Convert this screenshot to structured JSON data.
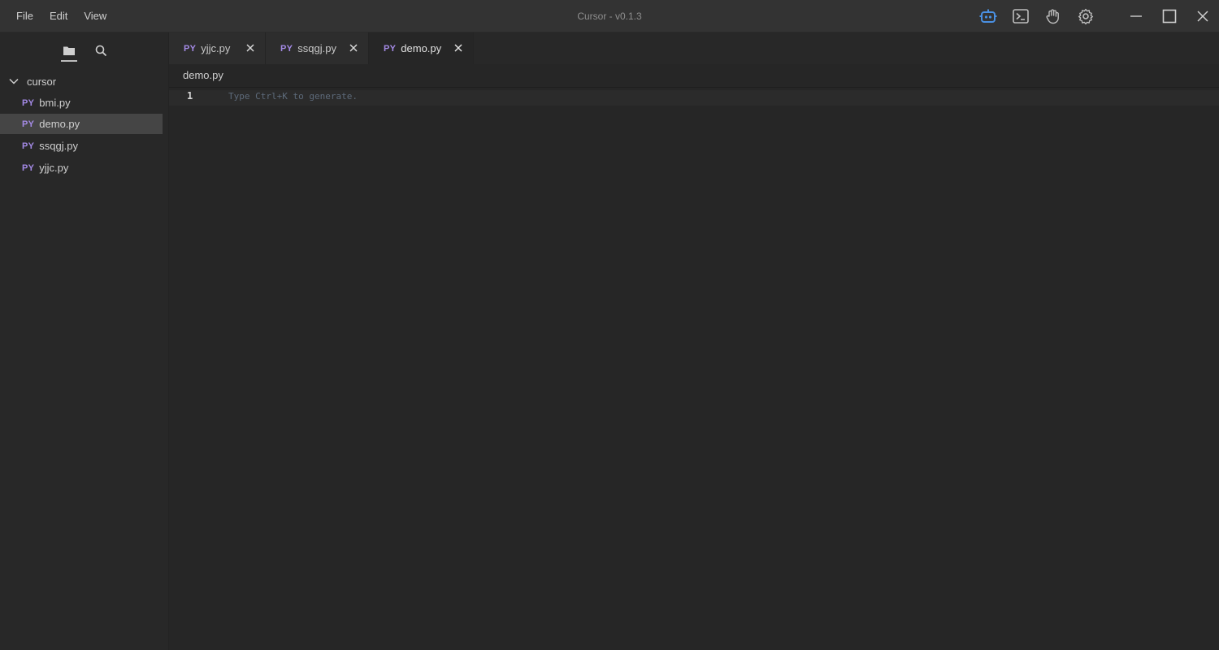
{
  "menu": [
    "File",
    "Edit",
    "View"
  ],
  "window": {
    "title": "Cursor - v0.1.3"
  },
  "title_icons": [
    "robot-icon",
    "terminal-icon",
    "hand-icon",
    "gear-icon"
  ],
  "colors": {
    "accent": "#4a90e2",
    "py_badge": "#a48ae6",
    "background": "#262626",
    "sidebar": "#282828",
    "titlebar": "#333333"
  },
  "sidebar": {
    "tabs": [
      "folder-icon",
      "search-icon"
    ],
    "folder": "cursor",
    "files": [
      {
        "badge": "PY",
        "name": "bmi.py",
        "selected": false
      },
      {
        "badge": "PY",
        "name": "demo.py",
        "selected": true
      },
      {
        "badge": "PY",
        "name": "ssqgj.py",
        "selected": false
      },
      {
        "badge": "PY",
        "name": "yjjc.py",
        "selected": false
      }
    ]
  },
  "tabs": [
    {
      "badge": "PY",
      "name": "yjjc.py",
      "active": false
    },
    {
      "badge": "PY",
      "name": "ssqgj.py",
      "active": false
    },
    {
      "badge": "PY",
      "name": "demo.py",
      "active": true
    }
  ],
  "breadcrumb": "demo.py",
  "editor": {
    "line_number": "1",
    "placeholder": "Type Ctrl+K to generate."
  }
}
